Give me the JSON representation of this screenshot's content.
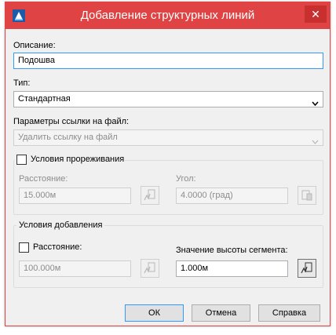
{
  "window": {
    "title": "Добавление структурных линий",
    "close_glyph": "✕"
  },
  "description": {
    "label": "Описание:",
    "value": "Подошва"
  },
  "type": {
    "label": "Тип:",
    "value": "Стандартная"
  },
  "file_link": {
    "label": "Параметры ссылки на файл:",
    "value": "Удалить ссылку на файл"
  },
  "weeding": {
    "checkbox_label": "Условия прореживания",
    "checked": false,
    "distance_label": "Расстояние:",
    "distance_value": "15.000м",
    "angle_label": "Угол:",
    "angle_value": "4.0000 (град)"
  },
  "supplementing": {
    "group_label": "Условия добавления",
    "distance_checkbox_label": "Расстояние:",
    "checked": false,
    "distance_value": "100.000м",
    "segment_label": "Значение высоты сегмента:",
    "segment_value": "1.000м"
  },
  "buttons": {
    "ok": "ОК",
    "cancel": "Отмена",
    "help": "Справка"
  },
  "colors": {
    "titlebar": "#e04343",
    "focus": "#3399ff"
  }
}
